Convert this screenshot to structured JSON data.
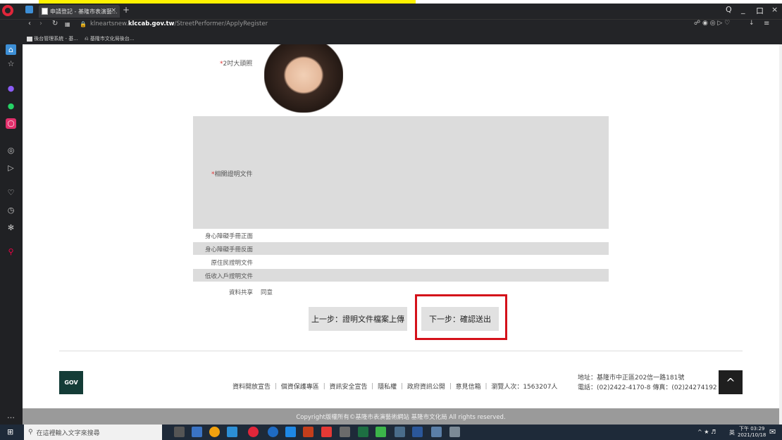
{
  "browser": {
    "tab_title": "申請登記 - 基隆市表演藝...",
    "tab_close": "×",
    "new_tab": "+",
    "url_prefix": "klneartsnew.",
    "url_host": "klccab.gov.tw",
    "url_path": "/StreetPerformer/ApplyRegister",
    "bookmarks": [
      "後台管理系統 - 基...",
      "基隆市文化局後台..."
    ],
    "window_controls": [
      "Q",
      "_",
      "口",
      "×"
    ]
  },
  "page": {
    "photo_label": "2吋大頭照",
    "docs_label": "相關證明文件",
    "rows": [
      {
        "label": "身心障礙手冊正面",
        "value": "",
        "shaded": false
      },
      {
        "label": "身心障礙手冊反面",
        "value": "",
        "shaded": true
      },
      {
        "label": "原住民證明文件",
        "value": "",
        "shaded": false
      },
      {
        "label": "低收入戶證明文件",
        "value": "",
        "shaded": true
      }
    ],
    "share_label": "資料共享",
    "share_value": "同意",
    "prev_button": "上一步：證明文件檔案上傳",
    "next_button": "下一步：確認送出"
  },
  "footer": {
    "gov_logo": "GOV",
    "links": "資料開放宣告 ｜ 個資保護專區 ｜ 資訊安全宣告 ｜ 隱私權 ｜ 政府資訊公開 ｜ 意見信箱 ｜ 瀏覽人次：1563207人",
    "address_line": "地址：基隆市中正區202信一路181號",
    "phone_line": "電話：(02)2422-4170-8 傳真：(02)24274192",
    "to_top": "^",
    "copyright": "Copyright版權所有©基隆市表演藝術網站 基隆市文化局 All rights reserved."
  },
  "taskbar": {
    "search_placeholder": "在這裡輸入文字來搜尋",
    "time": "下午 03:29",
    "date": "2021/10/18",
    "ime": "英"
  },
  "colors": {
    "chrome": "#232427",
    "accent_red": "#d4111a",
    "gov_green": "#143c37"
  }
}
